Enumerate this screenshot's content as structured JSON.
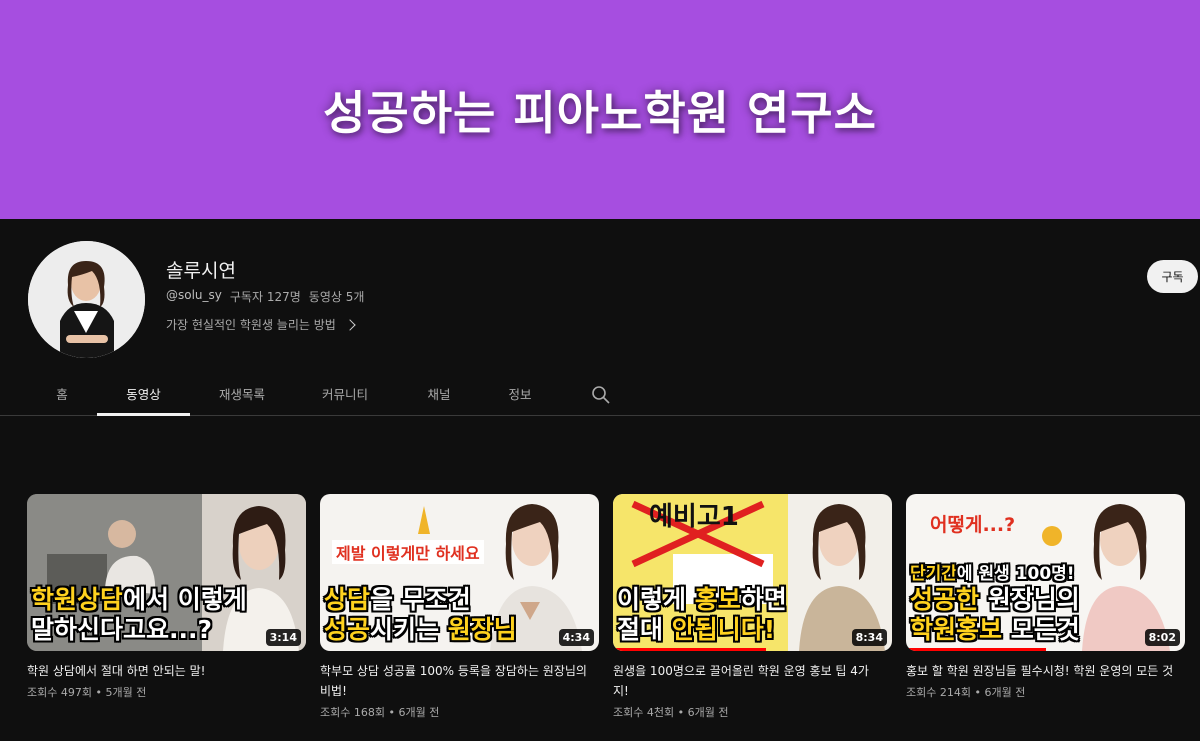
{
  "banner": {
    "title": "성공하는 피아노학원 연구소",
    "color": "#a64ee0"
  },
  "channel": {
    "name": "솔루시연",
    "handle": "@solu_sy",
    "subscribers": "구독자 127명",
    "videos_count": "동영상 5개",
    "description": "가장 현실적인 학원생 늘리는 방법",
    "subscribe_label": "구독"
  },
  "tabs": [
    {
      "label": "홈",
      "active": false
    },
    {
      "label": "동영상",
      "active": true
    },
    {
      "label": "재생목록",
      "active": false
    },
    {
      "label": "커뮤니티",
      "active": false
    },
    {
      "label": "채널",
      "active": false
    },
    {
      "label": "정보",
      "active": false
    }
  ],
  "videos": [
    {
      "title": "학원 상담에서 절대 하면 안되는 말!",
      "views": "조회수 497회",
      "age": "5개월 전",
      "duration": "3:14",
      "thumb_line1_hl": "학원상담",
      "thumb_line1_rest": "에서 이렇게",
      "thumb_line2": "말하신다고요...?"
    },
    {
      "title": "학부모 상담 성공률 100% 등록을 장담하는 원장님의 비법!",
      "views": "조회수 168회",
      "age": "6개월 전",
      "duration": "4:34",
      "thumb_top": "제발 이렇게만 하세요",
      "thumb_line1_hl": "상담",
      "thumb_line1_rest": "을 무조건",
      "thumb_line2_hl": "성공",
      "thumb_line2_rest": "시키는 ",
      "thumb_line2_hl2": "원장님"
    },
    {
      "title": "원생을 100명으로 끌어올린 학원 운영 홍보 팁 4가지!",
      "views": "조회수 4천회",
      "age": "6개월 전",
      "duration": "8:34",
      "thumb_top": "예비고1",
      "thumb_line1": "이렇게 ",
      "thumb_line1_hl": "홍보",
      "thumb_line1_rest": "하면",
      "thumb_line2": "절대 ",
      "thumb_line2_hl": "안됩니다!",
      "progress": 0.55
    },
    {
      "title": "홍보 할 학원 원장님들 필수시청! 학원 운영의 모든 것",
      "views": "조회수 214회",
      "age": "6개월 전",
      "duration": "8:02",
      "thumb_top": "어떻게...?",
      "thumb_sub_hl": "단기간",
      "thumb_sub_rest": "에 원생 100명!",
      "thumb_line1_hl": "성공한",
      "thumb_line1_rest": " 원장님의",
      "thumb_line2_hl": "학원홍보",
      "thumb_line2_rest": " 모든것",
      "progress": 0.5
    }
  ],
  "icons": {
    "search": "search-icon",
    "chevron": "chevron-right-icon"
  }
}
